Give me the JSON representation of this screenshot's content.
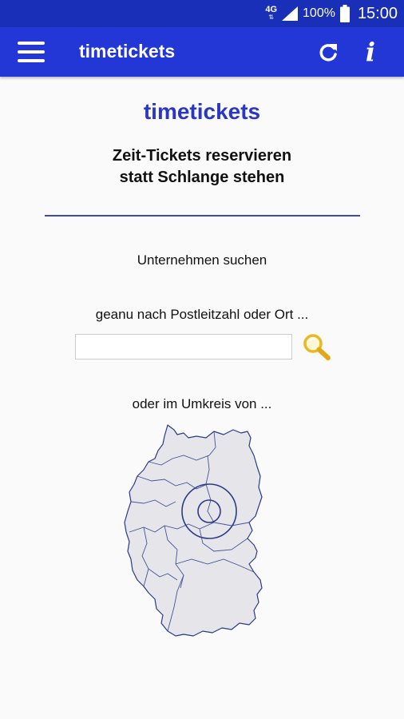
{
  "status_bar": {
    "network": "4G",
    "network_sub": "⇅",
    "battery": "100%",
    "time": "15:00"
  },
  "app_bar": {
    "title": "timetickets",
    "menu_icon": "hamburger-menu-icon",
    "refresh_icon": "refresh-icon",
    "info_icon": "info-icon",
    "info_glyph": "i"
  },
  "main": {
    "heading": "timetickets",
    "tagline_line1": "Zeit-Tickets reservieren",
    "tagline_line2": "statt Schlange stehen",
    "section_title": "Unternehmen suchen",
    "zip_label": "geanu nach Postleitzahl oder Ort ...",
    "search": {
      "value": "",
      "placeholder": ""
    },
    "radius_label": "oder im Umkreis von ..."
  },
  "colors": {
    "status_bar": "#1a2fb8",
    "app_bar": "#2337d6",
    "heading": "#2a36c6",
    "divider": "#4048b8",
    "magnifier": "#f1c232",
    "map_fill": "#e6e6ea",
    "map_stroke": "#2a3a8c"
  }
}
